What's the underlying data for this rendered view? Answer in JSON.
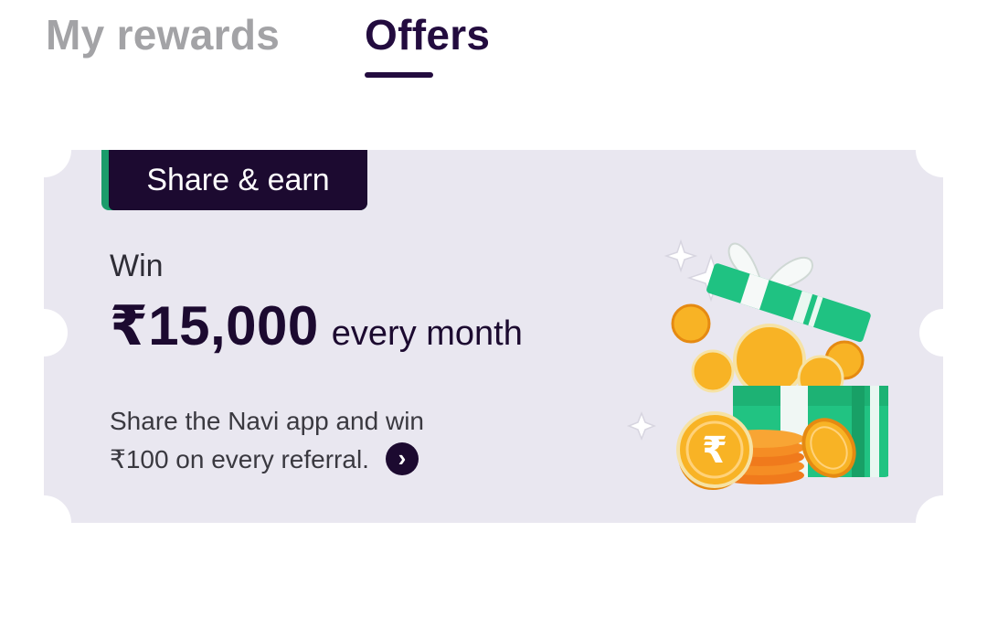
{
  "tabs": [
    {
      "label": "My rewards",
      "active": false
    },
    {
      "label": "Offers",
      "active": true
    }
  ],
  "offer_card": {
    "badge": "Share & earn",
    "win_label": "Win",
    "amount": "₹15,000",
    "period": "every month",
    "description_line1": "Share the Navi app and win",
    "description_line2": "₹100 on every referral.",
    "arrow_icon": "chevron-right-icon",
    "illustration": "gift-box-with-gold-coins",
    "colors": {
      "card_bg": "#e9e7f0",
      "dark": "#1c0a30",
      "green": "#1b9c6b",
      "gold": "#f4a921"
    }
  }
}
